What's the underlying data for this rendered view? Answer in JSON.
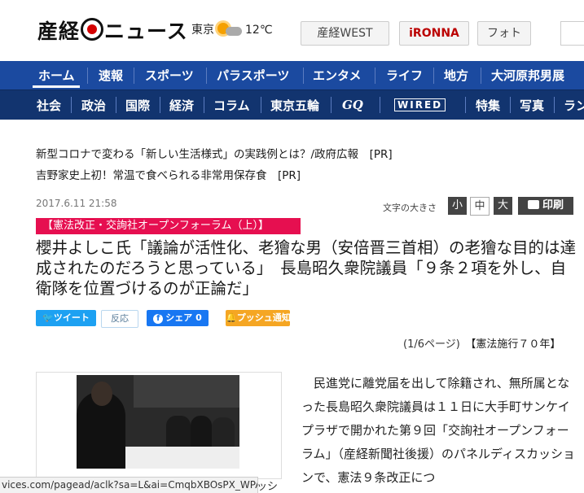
{
  "header": {
    "logo_text_before": "産経",
    "logo_text_after": "ニュース",
    "weather_city": "東京",
    "weather_temp": "12℃",
    "btn_west": "産経WEST",
    "btn_ironna": "iRONNA",
    "btn_photo": "フォト"
  },
  "nav_primary": [
    "ホーム",
    "速報",
    "スポーツ",
    "パラスポーツ",
    "エンタメ",
    "ライフ",
    "地方",
    "大河原邦男展"
  ],
  "nav_secondary": [
    "社会",
    "政治",
    "国際",
    "経済",
    "コラム",
    "東京五輪",
    "GQ",
    "WIRED",
    "特集",
    "写真",
    "ラン"
  ],
  "pr_links": [
    {
      "text": "新型コロナで変わる「新しい生活様式」の実践例とは？/政府広報",
      "tag": "[PR]"
    },
    {
      "text": "吉野家史上初！常温で食べられる非常用保存食",
      "tag": "[PR]"
    }
  ],
  "article": {
    "date": "2017.6.11 21:58",
    "textsize_label": "文字の大きさ",
    "size_small": "小",
    "size_medium": "中",
    "size_large": "大",
    "print_label": "印刷",
    "category": "【憲法改正・交詢社オープンフォーラム（上）】",
    "headline": "櫻井よしこ氏「議論が活性化、老獪な男（安倍晋三首相）の老獪な目的は達成されたのだろうと思っている」　長島昭久衆院議員「９条２項を外し、自衛隊を位置づけるのが正論だ」",
    "page_info": "(1/6ページ)",
    "series": "【憲法施行７０年】",
    "photo_caption": "ッシ",
    "body": "民進党に離党届を出して除籍され、無所属となった長島昭久衆院議員は１１日に大手町サンケイプラザで開かれた第９回「交詢社オープンフォーラム」（産経新聞社後援）のパネルディスカッションで、憲法９条改正につ"
  },
  "social": {
    "tweet": "ツイート",
    "tweet_count": "反応",
    "facebook": "シェア 0",
    "push": "プッシュ通知"
  },
  "status_bar": "vices.com/pagead/aclk?sa=L&ai=CmqbXBOsPX_WPAom..."
}
